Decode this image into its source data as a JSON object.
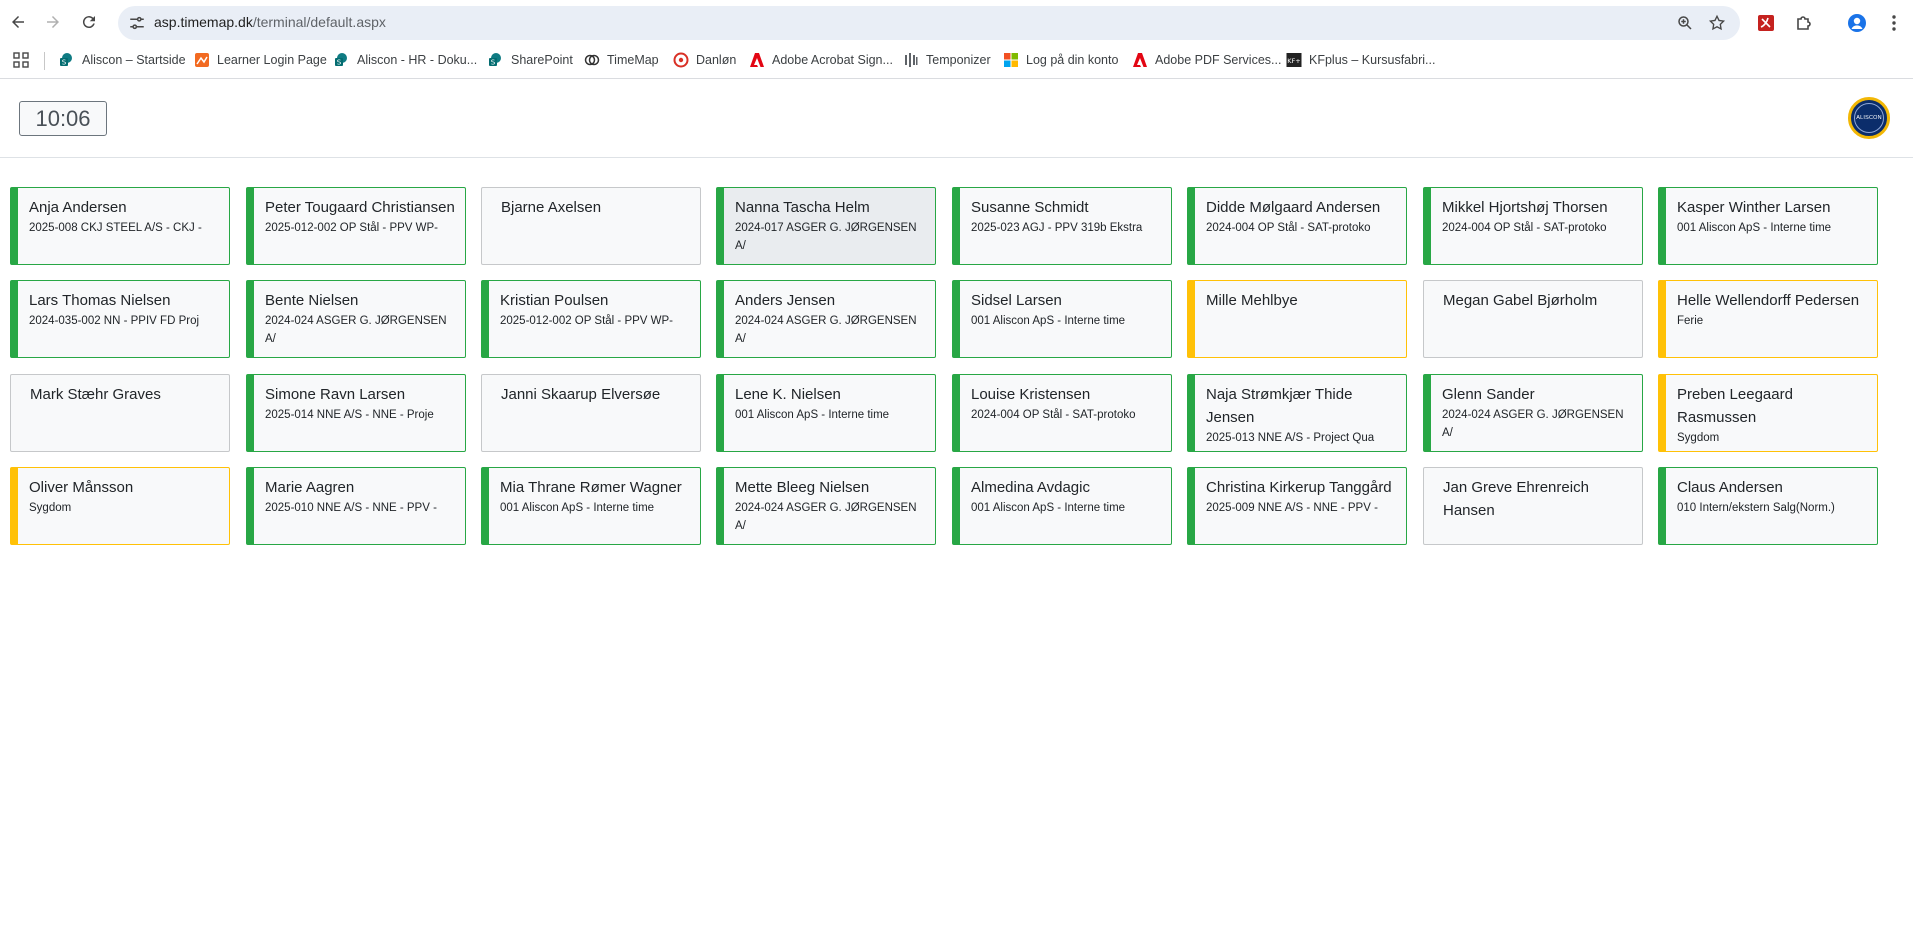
{
  "browser": {
    "url_host": "asp.timemap.dk",
    "url_path": "/terminal/default.aspx",
    "bookmarks": [
      {
        "label": "Aliscon – Startside",
        "icon": "sharepoint-icon"
      },
      {
        "label": "Learner Login Page",
        "icon": "learner-icon"
      },
      {
        "label": "Aliscon - HR - Doku...",
        "icon": "sharepoint-icon"
      },
      {
        "label": "SharePoint",
        "icon": "sharepoint-icon"
      },
      {
        "label": "TimeMap",
        "icon": "timemap-icon"
      },
      {
        "label": "Danløn",
        "icon": "danlon-icon"
      },
      {
        "label": "Adobe Acrobat Sign...",
        "icon": "adobe-icon"
      },
      {
        "label": "Temponizer",
        "icon": "temponizer-icon"
      },
      {
        "label": "Log på din konto",
        "icon": "microsoft-icon"
      },
      {
        "label": "Adobe PDF Services...",
        "icon": "adobe-icon"
      },
      {
        "label": "KFplus – Kursusfabri...",
        "icon": "kfplus-icon"
      }
    ]
  },
  "header": {
    "clock": "10:06",
    "logo_text": "ALISCON"
  },
  "colors": {
    "active": "#28a745",
    "absent": "#ffc107",
    "inactive": "#c6c8ca"
  },
  "employees": [
    {
      "name": "Anja Andersen",
      "task": "2025-008 CKJ STEEL A/S - CKJ -",
      "status": "active"
    },
    {
      "name": "Peter Tougaard Christiansen",
      "task": "2025-012-002 OP Stål - PPV WP-",
      "status": "active"
    },
    {
      "name": "Bjarne Axelsen",
      "task": "",
      "status": "inactive"
    },
    {
      "name": "Nanna Tascha Helm",
      "task": "2024-017 ASGER G. JØRGENSEN A/",
      "status": "active"
    },
    {
      "name": "Susanne Schmidt",
      "task": "2025-023 AGJ - PPV 319b Ekstra",
      "status": "active"
    },
    {
      "name": "Didde Mølgaard Andersen",
      "task": "2024-004 OP Stål - SAT-protoko",
      "status": "active"
    },
    {
      "name": "Mikkel Hjortshøj Thorsen",
      "task": "2024-004 OP Stål - SAT-protoko",
      "status": "active"
    },
    {
      "name": "Kasper Winther Larsen",
      "task": "001 Aliscon ApS - Interne time",
      "status": "active"
    },
    {
      "name": "Lars Thomas Nielsen",
      "task": "2024-035-002 NN - PPIV FD Proj",
      "status": "active"
    },
    {
      "name": "Bente Nielsen",
      "task": "2024-024 ASGER G. JØRGENSEN A/",
      "status": "active"
    },
    {
      "name": "Kristian Poulsen",
      "task": "2025-012-002 OP Stål - PPV WP-",
      "status": "active"
    },
    {
      "name": "Anders Jensen",
      "task": "2024-024 ASGER G. JØRGENSEN A/",
      "status": "active"
    },
    {
      "name": "Sidsel Larsen",
      "task": "001 Aliscon ApS - Interne time",
      "status": "active"
    },
    {
      "name": "Mille Mehlbye",
      "task": "",
      "status": "absent"
    },
    {
      "name": "Megan Gabel Bjørholm",
      "task": "",
      "status": "inactive"
    },
    {
      "name": "Helle Wellendorff Pedersen",
      "task": "Ferie",
      "status": "absent"
    },
    {
      "name": "Mark Stæhr Graves",
      "task": "",
      "status": "inactive"
    },
    {
      "name": "Simone Ravn Larsen",
      "task": "2025-014 NNE A/S - NNE - Proje",
      "status": "active"
    },
    {
      "name": "Janni Skaarup Elversøe",
      "task": "",
      "status": "inactive"
    },
    {
      "name": "Lene K. Nielsen",
      "task": "001 Aliscon ApS - Interne time",
      "status": "active"
    },
    {
      "name": "Louise Kristensen",
      "task": "2024-004 OP Stål - SAT-protoko",
      "status": "active"
    },
    {
      "name": "Naja Strømkjær Thide Jensen",
      "task": "2025-013 NNE A/S - Project Qua",
      "status": "active"
    },
    {
      "name": "Glenn Sander",
      "task": "2024-024 ASGER G. JØRGENSEN A/",
      "status": "active"
    },
    {
      "name": "Preben Leegaard Rasmussen",
      "task": "Sygdom",
      "status": "absent"
    },
    {
      "name": "Oliver Månsson",
      "task": "Sygdom",
      "status": "absent"
    },
    {
      "name": "Marie Aagren",
      "task": "2025-010 NNE A/S - NNE - PPV -",
      "status": "active"
    },
    {
      "name": "Mia Thrane Rømer Wagner",
      "task": "001 Aliscon ApS - Interne time",
      "status": "active"
    },
    {
      "name": "Mette Bleeg Nielsen",
      "task": "2024-024 ASGER G. JØRGENSEN A/",
      "status": "active"
    },
    {
      "name": "Almedina Avdagic",
      "task": "001 Aliscon ApS - Interne time",
      "status": "active"
    },
    {
      "name": "Christina Kirkerup Tanggård",
      "task": "2025-009 NNE A/S - NNE - PPV -",
      "status": "active"
    },
    {
      "name": "Jan Greve Ehrenreich Hansen",
      "task": "",
      "status": "inactive"
    },
    {
      "name": "Claus Andersen",
      "task": "010 Intern/ekstern Salg(Norm.)",
      "status": "active"
    }
  ]
}
